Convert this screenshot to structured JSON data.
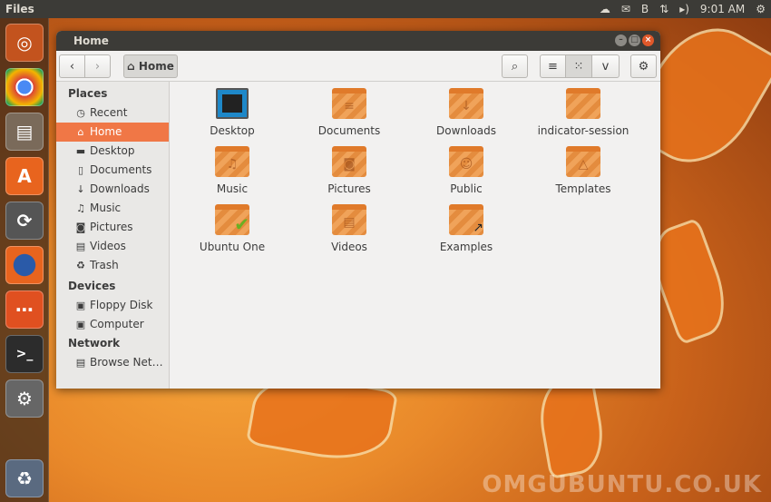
{
  "panel": {
    "app_name": "Files",
    "time": "9:01 AM",
    "indicators": [
      "cloud-icon",
      "mail-icon",
      "bluetooth-icon",
      "network-icon",
      "volume-icon",
      "gear-icon"
    ]
  },
  "launcher": [
    "ubuntu-dash",
    "chrome",
    "files",
    "software-center",
    "update-manager",
    "firefox",
    "chat",
    "terminal",
    "system-settings",
    "trash"
  ],
  "window": {
    "title": "Home",
    "path_button": "Home"
  },
  "sidebar": {
    "places_header": "Places",
    "places": [
      {
        "label": "Recent",
        "icon": "⏲"
      },
      {
        "label": "Home",
        "icon": "⌂"
      },
      {
        "label": "Desktop",
        "icon": "▬"
      },
      {
        "label": "Documents",
        "icon": "🗋"
      },
      {
        "label": "Downloads",
        "icon": "↓"
      },
      {
        "label": "Music",
        "icon": "♫"
      },
      {
        "label": "Pictures",
        "icon": "◙"
      },
      {
        "label": "Videos",
        "icon": "▤"
      },
      {
        "label": "Trash",
        "icon": "🗑"
      }
    ],
    "devices_header": "Devices",
    "devices": [
      {
        "label": "Floppy Disk",
        "icon": "💾"
      },
      {
        "label": "Computer",
        "icon": "▣"
      }
    ],
    "network_header": "Network",
    "network": [
      {
        "label": "Browse Net…",
        "icon": "🖧"
      }
    ]
  },
  "items": [
    {
      "label": "Desktop",
      "glyph": ""
    },
    {
      "label": "Documents",
      "glyph": "≡"
    },
    {
      "label": "Downloads",
      "glyph": "↓"
    },
    {
      "label": "indicator-session",
      "glyph": ""
    },
    {
      "label": "Music",
      "glyph": "♫"
    },
    {
      "label": "Pictures",
      "glyph": "◙"
    },
    {
      "label": "Public",
      "glyph": "☺"
    },
    {
      "label": "Templates",
      "glyph": "△"
    },
    {
      "label": "Ubuntu One",
      "glyph": "✔"
    },
    {
      "label": "Videos",
      "glyph": "▤"
    },
    {
      "label": "Examples",
      "glyph": "↗"
    }
  ],
  "watermark": "OMGUBUNTU.CO.UK"
}
